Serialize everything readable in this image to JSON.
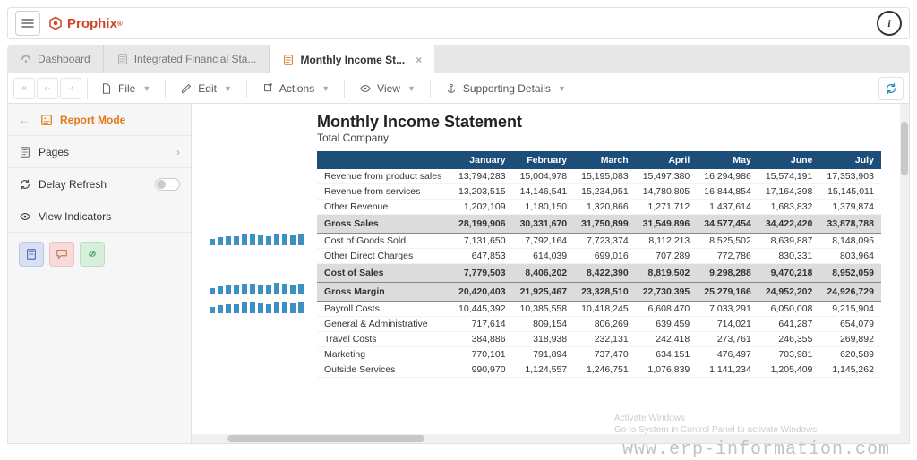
{
  "header": {
    "brand": "Prophix",
    "info_label": "i"
  },
  "tabs": [
    {
      "label": "Dashboard",
      "icon": "gauge",
      "active": false
    },
    {
      "label": "Integrated Financial Sta...",
      "icon": "doc",
      "active": false
    },
    {
      "label": "Monthly Income St...",
      "icon": "doc-orange",
      "active": true,
      "closable": true
    }
  ],
  "toolbar": {
    "file": "File",
    "edit": "Edit",
    "actions": "Actions",
    "view": "View",
    "supporting": "Supporting Details"
  },
  "sidebar": {
    "mode": "Report Mode",
    "pages": "Pages",
    "delay_refresh": "Delay Refresh",
    "view_indicators": "View Indicators"
  },
  "report": {
    "title": "Monthly Income Statement",
    "subtitle": "Total Company",
    "columns": [
      "January",
      "February",
      "March",
      "April",
      "May",
      "June",
      "July"
    ],
    "rows": [
      {
        "type": "row",
        "label": "Revenue from product sales",
        "vals": [
          "13,794,283",
          "15,004,978",
          "15,195,083",
          "15,497,380",
          "16,294,986",
          "15,574,191",
          "17,353,903"
        ]
      },
      {
        "type": "row",
        "label": "Revenue from services",
        "vals": [
          "13,203,515",
          "14,146,541",
          "15,234,951",
          "14,780,805",
          "16,844,854",
          "17,164,398",
          "15,145,011"
        ]
      },
      {
        "type": "row",
        "label": "Other Revenue",
        "vals": [
          "1,202,109",
          "1,180,150",
          "1,320,866",
          "1,271,712",
          "1,437,614",
          "1,683,832",
          "1,379,874"
        ]
      },
      {
        "type": "section",
        "label": "Gross Sales",
        "vals": [
          "28,199,906",
          "30,331,670",
          "31,750,899",
          "31,549,896",
          "34,577,454",
          "34,422,420",
          "33,878,788"
        ]
      },
      {
        "type": "row",
        "label": "Cost of Goods Sold",
        "vals": [
          "7,131,650",
          "7,792,164",
          "7,723,374",
          "8,112,213",
          "8,525,502",
          "8,639,887",
          "8,148,095"
        ]
      },
      {
        "type": "row",
        "label": "Other Direct Charges",
        "vals": [
          "647,853",
          "614,039",
          "699,016",
          "707,289",
          "772,786",
          "830,331",
          "803,964"
        ]
      },
      {
        "type": "section",
        "label": "Cost of Sales",
        "vals": [
          "7,779,503",
          "8,406,202",
          "8,422,390",
          "8,819,502",
          "9,298,288",
          "9,470,218",
          "8,952,059"
        ]
      },
      {
        "type": "section",
        "label": "Gross Margin",
        "vals": [
          "20,420,403",
          "21,925,467",
          "23,328,510",
          "22,730,395",
          "25,279,166",
          "24,952,202",
          "24,926,729"
        ]
      },
      {
        "type": "row",
        "label": "Payroll Costs",
        "vals": [
          "10,445,392",
          "10,385,558",
          "10,418,245",
          "6,608,470",
          "7,033,291",
          "6,050,008",
          "9,215,904"
        ]
      },
      {
        "type": "row",
        "label": "General & Administrative",
        "vals": [
          "717,614",
          "809,154",
          "806,269",
          "639,459",
          "714,021",
          "641,287",
          "654,079"
        ]
      },
      {
        "type": "row",
        "label": "Travel Costs",
        "vals": [
          "384,886",
          "318,938",
          "232,131",
          "242,418",
          "273,761",
          "246,355",
          "269,892"
        ]
      },
      {
        "type": "row",
        "label": "Marketing",
        "vals": [
          "770,101",
          "791,894",
          "737,470",
          "634,151",
          "476,497",
          "703,981",
          "620,589"
        ]
      },
      {
        "type": "row",
        "label": "Outside Services",
        "vals": [
          "990,970",
          "1,124,557",
          "1,246,751",
          "1,076,839",
          "1,141,234",
          "1,205,409",
          "1,145,262"
        ]
      }
    ],
    "sparkline_rows": [
      "Gross Sales",
      "Cost of Sales",
      "Gross Margin"
    ]
  },
  "watermark": {
    "line1": "Activate Windows",
    "line2": "Go to System in Control Panel to activate Windows."
  },
  "url": "www.erp-information.com"
}
